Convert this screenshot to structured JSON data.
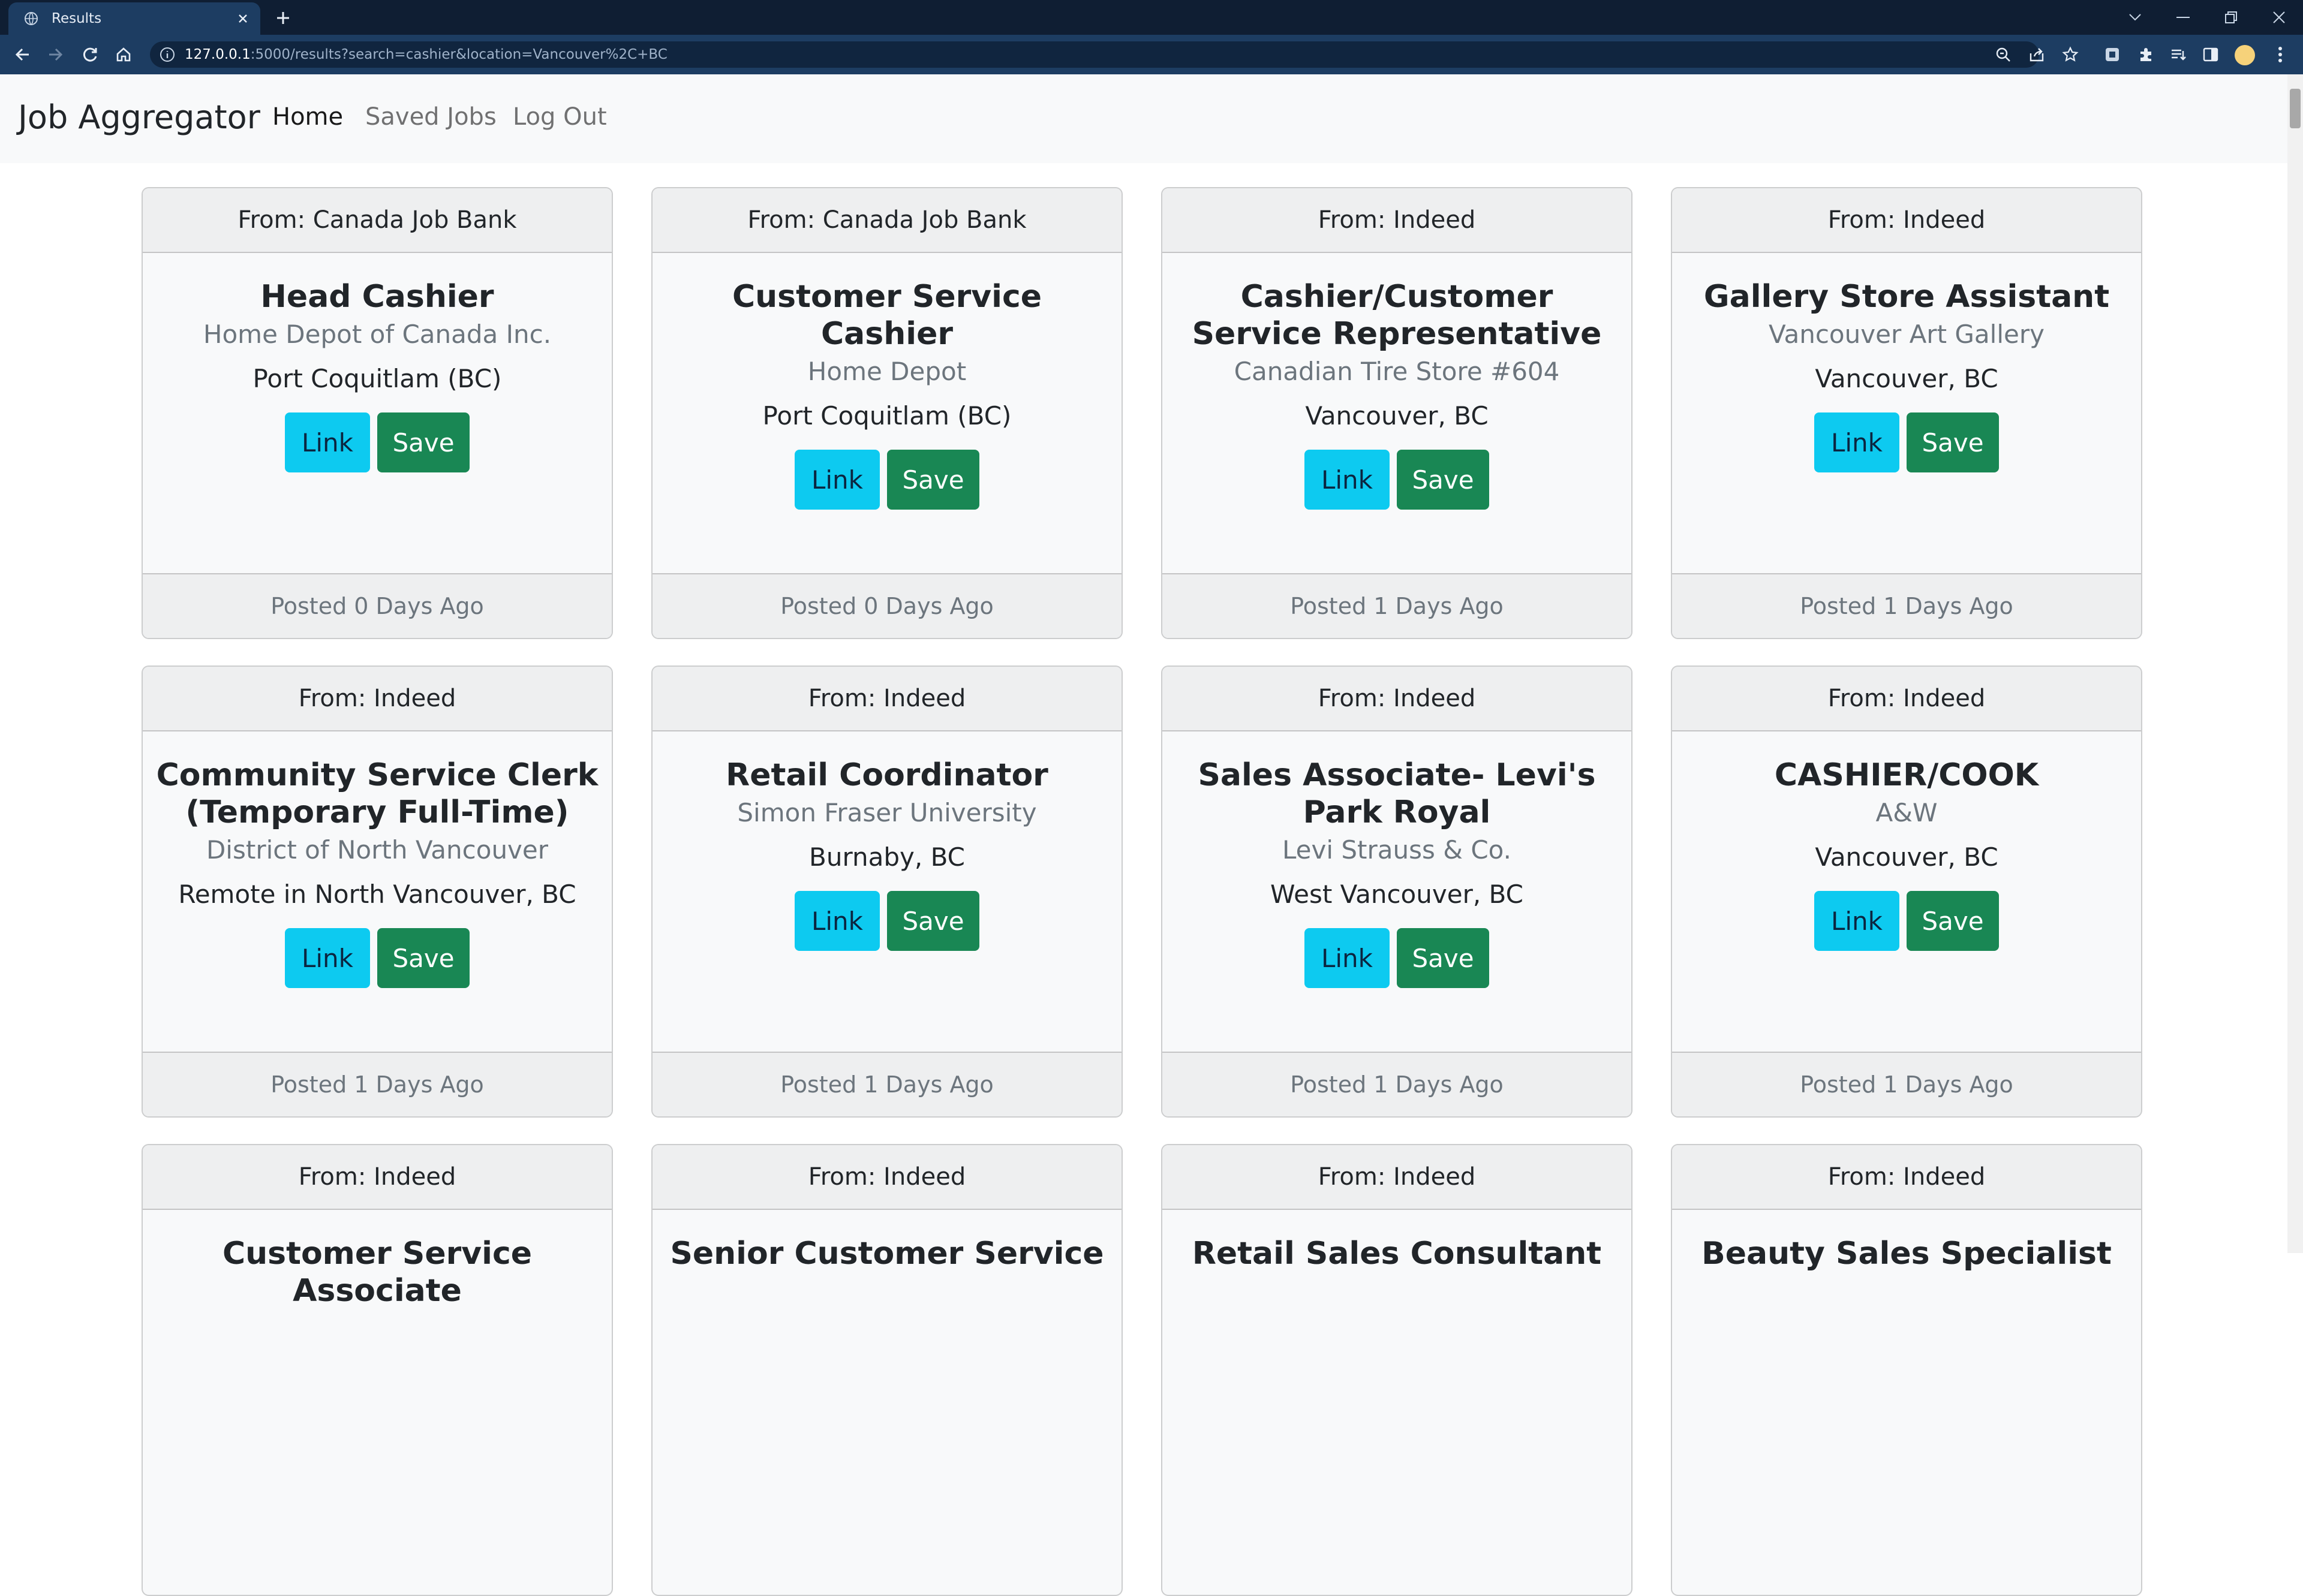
{
  "browser": {
    "tab_title": "Results",
    "url_host": "127.0.0.1",
    "url_rest": ":5000/results?search=cashier&location=Vancouver%2C+BC"
  },
  "navbar": {
    "brand": "Job Aggregator",
    "links": [
      "Home",
      "Saved Jobs",
      "Log Out"
    ]
  },
  "buttons": {
    "link": "Link",
    "save": "Save"
  },
  "jobs": [
    {
      "source": "From: Canada Job Bank",
      "title": "Head Cashier",
      "company": "Home Depot of Canada Inc.",
      "location": "Port Coquitlam (BC)",
      "posted": "Posted 0 Days Ago"
    },
    {
      "source": "From: Canada Job Bank",
      "title": "Customer Service Cashier",
      "company": "Home Depot",
      "location": "Port Coquitlam (BC)",
      "posted": "Posted 0 Days Ago"
    },
    {
      "source": "From: Indeed",
      "title": "Cashier/Customer Service Representative",
      "company": "Canadian Tire Store #604",
      "location": "Vancouver, BC",
      "posted": "Posted 1 Days Ago"
    },
    {
      "source": "From: Indeed",
      "title": "Gallery Store Assistant",
      "company": "Vancouver Art Gallery",
      "location": "Vancouver, BC",
      "posted": "Posted 1 Days Ago"
    },
    {
      "source": "From: Indeed",
      "title": "Community Service Clerk (Temporary Full-Time)",
      "company": "District of North Vancouver",
      "location": "Remote in North Vancouver, BC",
      "posted": "Posted 1 Days Ago"
    },
    {
      "source": "From: Indeed",
      "title": "Retail Coordinator",
      "company": "Simon Fraser University",
      "location": "Burnaby, BC",
      "posted": "Posted 1 Days Ago"
    },
    {
      "source": "From: Indeed",
      "title": "Sales Associate- Levi's Park Royal",
      "company": "Levi Strauss & Co.",
      "location": "West Vancouver, BC",
      "posted": "Posted 1 Days Ago"
    },
    {
      "source": "From: Indeed",
      "title": "CASHIER/COOK",
      "company": "A&W",
      "location": "Vancouver, BC",
      "posted": "Posted 1 Days Ago"
    },
    {
      "source": "From: Indeed",
      "title": "Customer Service Associate",
      "company": "",
      "location": "",
      "posted": ""
    },
    {
      "source": "From: Indeed",
      "title": "Senior Customer Service",
      "company": "",
      "location": "",
      "posted": ""
    },
    {
      "source": "From: Indeed",
      "title": "Retail Sales Consultant",
      "company": "",
      "location": "",
      "posted": ""
    },
    {
      "source": "From: Indeed",
      "title": "Beauty Sales Specialist",
      "company": "",
      "location": "",
      "posted": ""
    }
  ]
}
